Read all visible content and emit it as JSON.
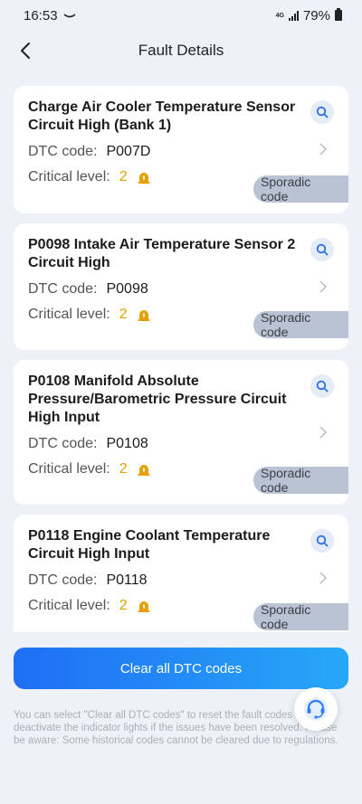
{
  "status_bar": {
    "time": "16:53",
    "network": "4G",
    "battery": "79%"
  },
  "header": {
    "title": "Fault Details"
  },
  "labels": {
    "dtc": "DTC code:",
    "critical": "Critical level:"
  },
  "faults": [
    {
      "title": "Charge Air Cooler Temperature Sensor Circuit High (Bank 1)",
      "code": "P007D",
      "level": "2",
      "badge": "Sporadic code"
    },
    {
      "title": "P0098 Intake Air Temperature Sensor 2 Circuit High",
      "code": "P0098",
      "level": "2",
      "badge": "Sporadic code"
    },
    {
      "title": "P0108 Manifold Absolute Pressure/Barometric Pressure Circuit High Input",
      "code": "P0108",
      "level": "2",
      "badge": "Sporadic code"
    },
    {
      "title": "P0118 Engine Coolant Temperature Circuit High Input",
      "code": "P0118",
      "level": "2",
      "badge": "Sporadic code"
    }
  ],
  "clear_button": "Clear all DTC codes",
  "note": "You can select \"Clear all DTC codes\" to reset the fault codes and deactivate the indicator lights if the issues have been resolved. Please be aware: Some historical codes cannot be cleared due to regulations.",
  "colors": {
    "accent_start": "#1f6ef5",
    "accent_end": "#27a8f7",
    "critical": "#e6a000",
    "badge_bg": "#b9c3d3",
    "background": "#eef2f8"
  },
  "icons": {
    "back": "back-arrow-icon",
    "search": "search-icon",
    "chevron": "chevron-right-icon",
    "alarm": "alarm-light-icon",
    "support": "headset-support-icon"
  }
}
